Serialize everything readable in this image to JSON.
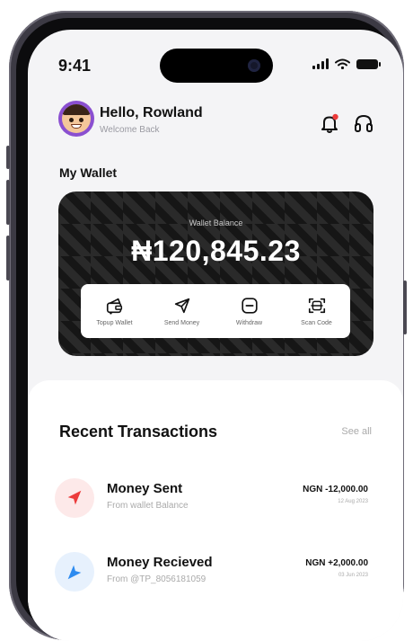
{
  "status_bar": {
    "time": "9:41"
  },
  "header": {
    "greeting": "Hello, Rowland",
    "subtitle": "Welcome Back"
  },
  "wallet": {
    "section_label": "My Wallet",
    "balance_label": "Wallet Balance",
    "balance": "₦120,845.23",
    "actions": [
      {
        "label": "Topup Wallet",
        "icon": "wallet-topup-icon"
      },
      {
        "label": "Send Money",
        "icon": "send-icon"
      },
      {
        "label": "Withdraw",
        "icon": "withdraw-icon"
      },
      {
        "label": "Scan Code",
        "icon": "scan-icon"
      }
    ]
  },
  "transactions": {
    "title": "Recent Transactions",
    "see_all": "See all",
    "items": [
      {
        "title": "Money Sent",
        "subtitle": "From wallet Balance",
        "amount": "NGN -12,000.00",
        "date": "12 Aug 2023",
        "color": "#ec3b3b"
      },
      {
        "title": "Money Recieved",
        "subtitle": "From @TP_8056181059",
        "amount": "NGN +2,000.00",
        "date": "03 Jun 2023",
        "color": "#2d8bf0"
      }
    ]
  },
  "colors": {
    "accent": "#8a4fd0",
    "notification_dot": "#ec3b3b",
    "sent": "#ec3b3b",
    "received": "#2d8bf0"
  }
}
